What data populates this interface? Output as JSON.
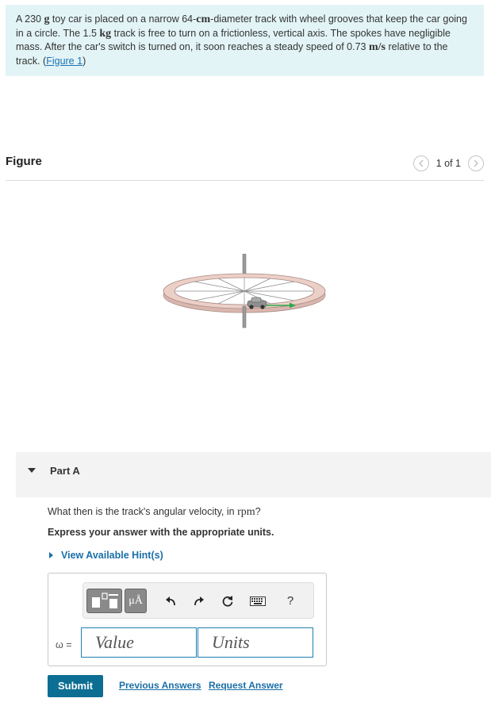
{
  "problem": {
    "p1": "A 230 ",
    "g": "g",
    "p2": " toy car is placed on a narrow 64-",
    "cm": "cm",
    "p3": "-diameter track with wheel grooves that keep the car going in a circle. The 1.5 ",
    "kg": "kg",
    "p4": " track is free to turn on a frictionless, vertical axis. The spokes have negligible mass. After the car's switch is turned on, it soon reaches a steady speed of 0.73 ",
    "ms": "m/s",
    "p5": " relative to the track. (",
    "link": "Figure 1",
    "p6": ")"
  },
  "figure": {
    "title": "Figure",
    "count": "1 of 1",
    "prev_icon": "chevron-left-icon",
    "next_icon": "chevron-right-icon"
  },
  "part": {
    "label": "Part A",
    "question_pre": "What then is the track's angular velocity, in ",
    "question_unit": "rpm",
    "question_post": "?",
    "instruction": "Express your answer with the appropriate units.",
    "hint": "View Available Hint(s)"
  },
  "answer": {
    "mu_label": "μÅ",
    "help_label": "?",
    "omega_label": "ω =",
    "value_placeholder": "Value",
    "units_placeholder": "Units"
  },
  "actions": {
    "submit": "Submit",
    "previous": "Previous Answers",
    "request": "Request Answer"
  },
  "colors": {
    "problem_bg": "#e3f4f6",
    "link": "#1a73b8",
    "submit_bg": "#0c6e93",
    "input_border": "#1f7fb0"
  }
}
